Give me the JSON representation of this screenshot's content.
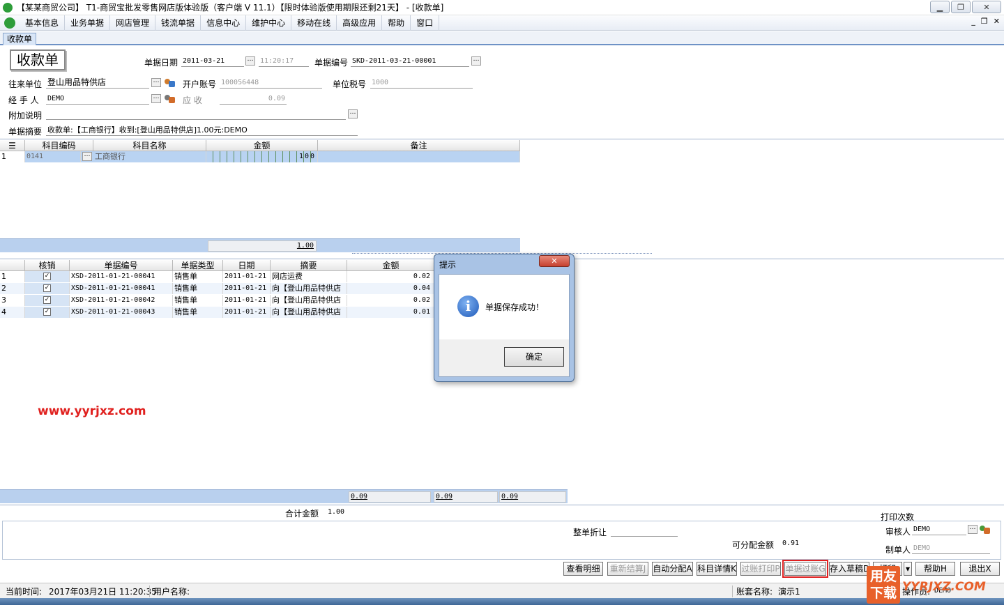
{
  "window": {
    "title": "【某某商贸公司】 T1-商贸宝批发零售网店版体验版（客户端 V 11.1）【限时体验版使用期限还剩21天】 - [收款单]"
  },
  "menu": [
    "基本信息",
    "业务单据",
    "网店管理",
    "钱流单据",
    "信息中心",
    "维护中心",
    "移动在线",
    "高级应用",
    "帮助",
    "窗口"
  ],
  "tab": "收款单",
  "form": {
    "doc_title": "收款单",
    "date_label": "单据日期",
    "date_value": "2011-03-21",
    "time_value": "11:20:17",
    "number_label": "单据编号",
    "number_value": "SKD-2011-03-21-00001",
    "partner_label": "往来单位",
    "partner_value": "登山用品特供店",
    "account_label": "开户账号",
    "account_value": "100056448",
    "tax_label": "单位税号",
    "tax_value": "1000",
    "handler_label": "经 手 人",
    "handler_value": "DEMO",
    "receivable_label": "应    收",
    "receivable_value": "0.09",
    "note_label": "附加说明",
    "summary_label": "单据摘要",
    "summary_value": "收款单:【工商银行】收到:[登山用品特供店]1.00元:DEMO"
  },
  "grid1": {
    "columns": [
      "科目编码",
      "科目名称",
      "金额",
      "备注"
    ],
    "rows": [
      {
        "no": "1",
        "code": "0141",
        "name": "工商银行",
        "amount": "100"
      }
    ],
    "total": "1.00"
  },
  "grid2": {
    "columns": [
      "核销",
      "单据编号",
      "单据类型",
      "日期",
      "摘要",
      "金额"
    ],
    "rows": [
      {
        "no": "1",
        "checked": "✓",
        "number": "XSD-2011-01-21-00041",
        "type": "销售单",
        "date": "2011-01-21",
        "summary": "网店运费",
        "amount": "0.02"
      },
      {
        "no": "2",
        "checked": "✓",
        "number": "XSD-2011-01-21-00041",
        "type": "销售单",
        "date": "2011-01-21",
        "summary": "向【登山用品特供店",
        "amount": "0.04"
      },
      {
        "no": "3",
        "checked": "✓",
        "number": "XSD-2011-01-21-00042",
        "type": "销售单",
        "date": "2011-01-21",
        "summary": "向【登山用品特供店",
        "amount": "0.02"
      },
      {
        "no": "4",
        "checked": "✓",
        "number": "XSD-2011-01-21-00043",
        "type": "销售单",
        "date": "2011-01-21",
        "summary": "向【登山用品特供店",
        "amount": "0.01"
      }
    ],
    "totals": [
      "0.09",
      "0.09",
      "0.09"
    ]
  },
  "watermark": "www.yyrjxz.com",
  "bottom": {
    "total_label": "合计金额",
    "total_value": "1.00",
    "print_count_label": "打印次数",
    "discount_label": "整单折让",
    "distributable_label": "可分配金额",
    "distributable_value": "0.91",
    "auditor_label": "审核人",
    "auditor_value": "DEMO",
    "maker_label": "制单人",
    "maker_value": "DEMO"
  },
  "buttons": {
    "view_detail": "查看明细",
    "recalc": "重新结算J",
    "auto_alloc": "自动分配A",
    "subject_detail": "科目详情K",
    "post_print": "过账打印P",
    "post": "单据过账G",
    "save_draft": "存入草稿D",
    "print": "打印",
    "help": "帮助H",
    "exit": "退出X"
  },
  "status": {
    "time_label": "当前时间:",
    "time_value": "2017年03月21日 11:20:35",
    "user_label": "用户名称:",
    "set_label": "账套名称:",
    "set_value": "演示1",
    "operator_label": "操作员:",
    "operator_value": "DEMO"
  },
  "logo": {
    "badge_top": "用友",
    "badge_bottom": "下载",
    "text": "YYRJXZ.COM"
  },
  "dialog": {
    "title": "提示",
    "message": "单据保存成功！",
    "ok": "确定",
    "close": "✕"
  }
}
